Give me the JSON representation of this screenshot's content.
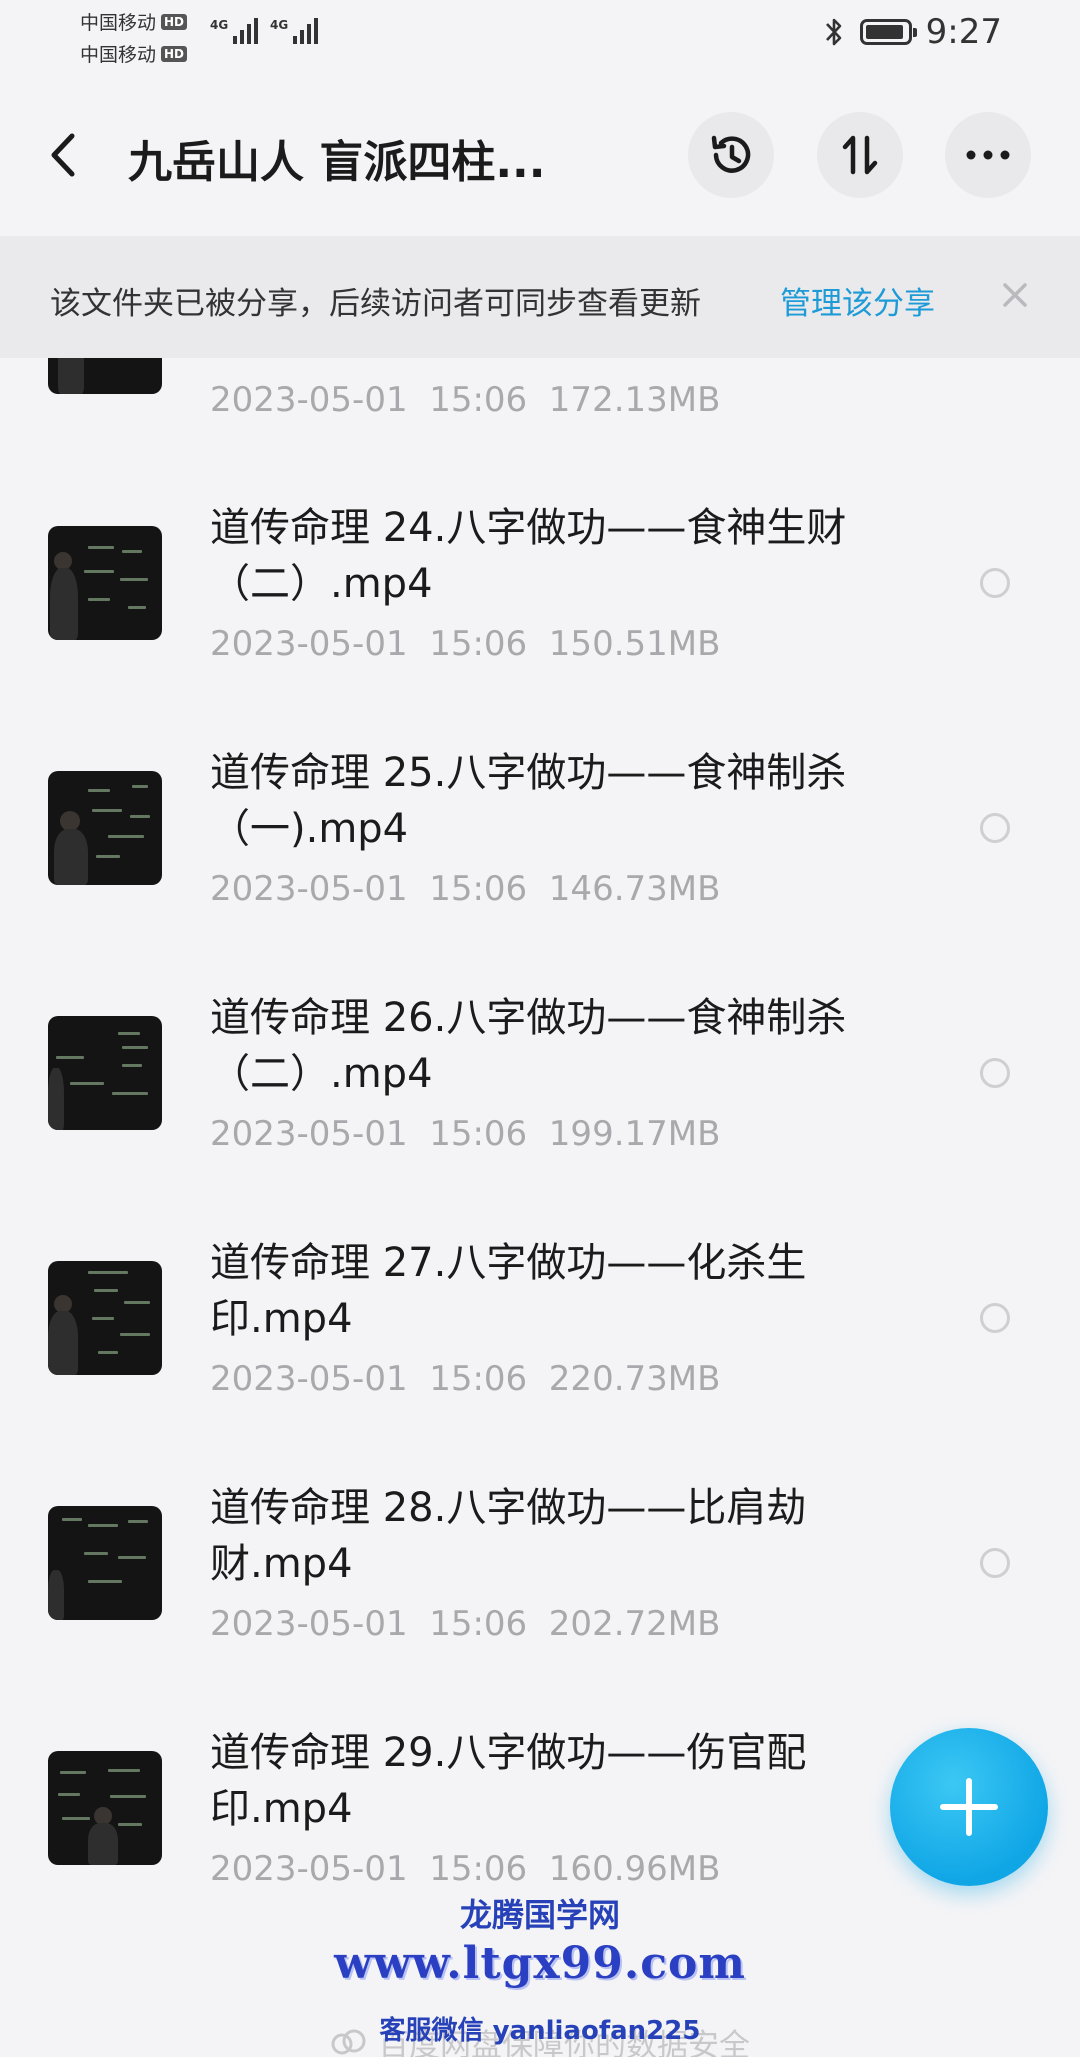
{
  "status_bar": {
    "carrier1": "中国移动",
    "carrier2": "中国移动",
    "hd": "HD",
    "net1": "4G",
    "net2": "4G",
    "time": "9:27"
  },
  "header": {
    "title": "九岳山人 盲派四柱...",
    "back_icon": "chevron-left-icon",
    "history_icon": "history-clock-icon",
    "sort_icon": "sort-arrows-icon",
    "more_icon": "more-dots-icon"
  },
  "share_banner": {
    "text": "该文件夹已被分享，后续访问者可同步查看更新",
    "link": "管理该分享",
    "close_icon": "close-icon"
  },
  "files": [
    {
      "name": "",
      "date": "2023-05-01",
      "time": "15:06",
      "size": "172.13MB",
      "meta": "2023-05-01  15:06  172.13MB"
    },
    {
      "name": "道传命理 24.八字做功——食神生财（二）.mp4",
      "meta": "2023-05-01  15:06  150.51MB"
    },
    {
      "name": "道传命理 25.八字做功——食神制杀（一).mp4",
      "meta": "2023-05-01  15:06  146.73MB"
    },
    {
      "name": "道传命理 26.八字做功——食神制杀（二）.mp4",
      "meta": "2023-05-01  15:06  199.17MB"
    },
    {
      "name": "道传命理 27.八字做功——化杀生印.mp4",
      "meta": "2023-05-01  15:06  220.73MB"
    },
    {
      "name": "道传命理 28.八字做功——比肩劫财.mp4",
      "meta": "2023-05-01  15:06  202.72MB"
    },
    {
      "name": "道传命理 29.八字做功——伤官配印.mp4",
      "meta": "2023-05-01  15:06  160.96MB"
    }
  ],
  "fab": {
    "icon": "plus-icon"
  },
  "watermark": {
    "name": "龙腾国学网",
    "url": "www.ltgx99.com",
    "contact": "客服微信 yanliaofan225"
  },
  "footer": {
    "text": "百度网盘保障你的数据安全",
    "icon": "baidu-cloud-icon"
  },
  "colors": {
    "accent": "#1e9bd6",
    "fab": "#10a6e6",
    "background": "#f4f4f6",
    "watermark": "#2a3fc2"
  }
}
